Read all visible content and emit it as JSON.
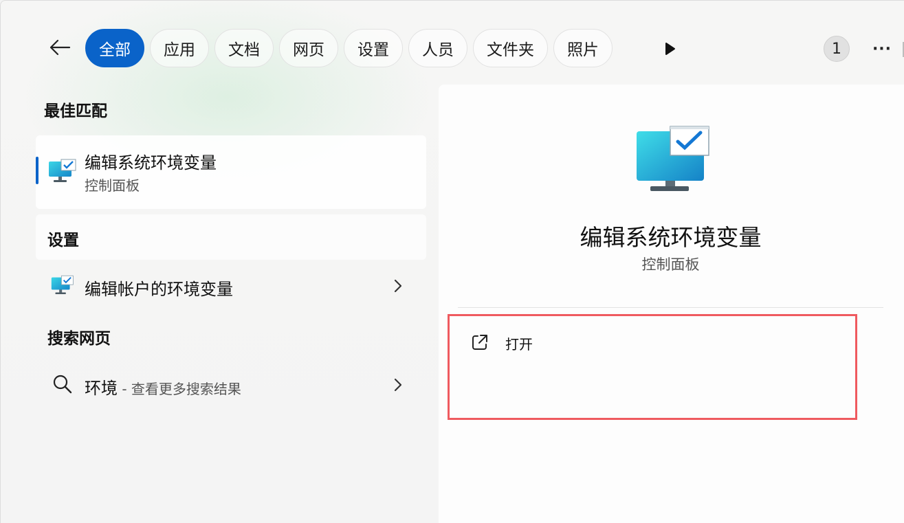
{
  "filter_bar": {
    "tabs": [
      {
        "label": "全部",
        "active": true
      },
      {
        "label": "应用",
        "active": false
      },
      {
        "label": "文档",
        "active": false
      },
      {
        "label": "网页",
        "active": false
      },
      {
        "label": "设置",
        "active": false
      },
      {
        "label": "人员",
        "active": false
      },
      {
        "label": "文件夹",
        "active": false
      },
      {
        "label": "照片",
        "active": false
      }
    ],
    "badge_count": "1",
    "more_label": "···"
  },
  "results": {
    "best_match_header": "最佳匹配",
    "best_match": {
      "title": "编辑系统环境变量",
      "subtitle": "控制面板"
    },
    "settings_header": "设置",
    "settings_items": [
      {
        "label": "编辑帐户的环境变量"
      }
    ],
    "web_header": "搜索网页",
    "web_items": [
      {
        "query": "环境",
        "suffix": " - 查看更多搜索结果"
      }
    ]
  },
  "detail": {
    "title": "编辑系统环境变量",
    "subtitle": "控制面板",
    "actions": [
      {
        "label": "打开",
        "icon": "open-external-icon"
      }
    ]
  },
  "colors": {
    "accent": "#0a63c9",
    "highlight": "#ef5a5f"
  }
}
